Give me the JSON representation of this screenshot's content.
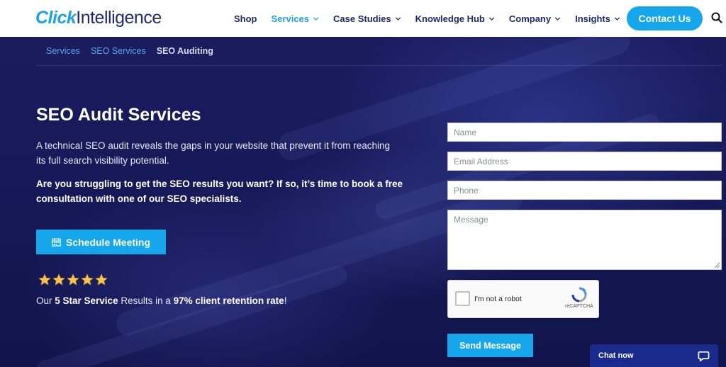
{
  "brand": {
    "logo_part1": "Click",
    "logo_part2": "Intelligence",
    "logo_color": "#1aa3e6",
    "logo_dark": "#1f2a78"
  },
  "nav": {
    "items": [
      {
        "label": "Shop",
        "dropdown": false,
        "active": false
      },
      {
        "label": "Services",
        "dropdown": true,
        "active": true
      },
      {
        "label": "Case Studies",
        "dropdown": true,
        "active": false
      },
      {
        "label": "Knowledge Hub",
        "dropdown": true,
        "active": false
      },
      {
        "label": "Company",
        "dropdown": true,
        "active": false
      },
      {
        "label": "Insights",
        "dropdown": true,
        "active": false
      }
    ],
    "contact_label": "Contact Us",
    "search_icon": "search-icon"
  },
  "breadcrumb": [
    "Services",
    "SEO Services",
    "SEO Auditing"
  ],
  "hero": {
    "title": "SEO Audit Services",
    "description": "A technical SEO audit reveals the gaps in your website that prevent it from reaching its full search visibility potential.",
    "bold_text": "Are you struggling to get the SEO results you want? If so, it’s time to book a free consultation with one of our SEO specialists.",
    "schedule_label": "Schedule Meeting",
    "rating": {
      "stars": 5,
      "text_prefix": "Our ",
      "text_bold1": "5 Star Service",
      "text_mid": " Results in a ",
      "text_bold2": "97% client retention rate",
      "text_suffix": "!"
    }
  },
  "form": {
    "name_placeholder": "Name",
    "email_placeholder": "Email Address",
    "phone_placeholder": "Phone",
    "message_placeholder": "Message",
    "captcha_label": "I'm not a robot",
    "captcha_brand": "reCAPTCHA",
    "send_label": "Send Message"
  },
  "chat": {
    "label": "Chat now"
  },
  "colors": {
    "accent": "#15a6ec",
    "nav_text": "#1d2a6b",
    "hero_bg": "#161856",
    "star": "#f4c14d",
    "chat_bg": "#1a2a8c"
  }
}
